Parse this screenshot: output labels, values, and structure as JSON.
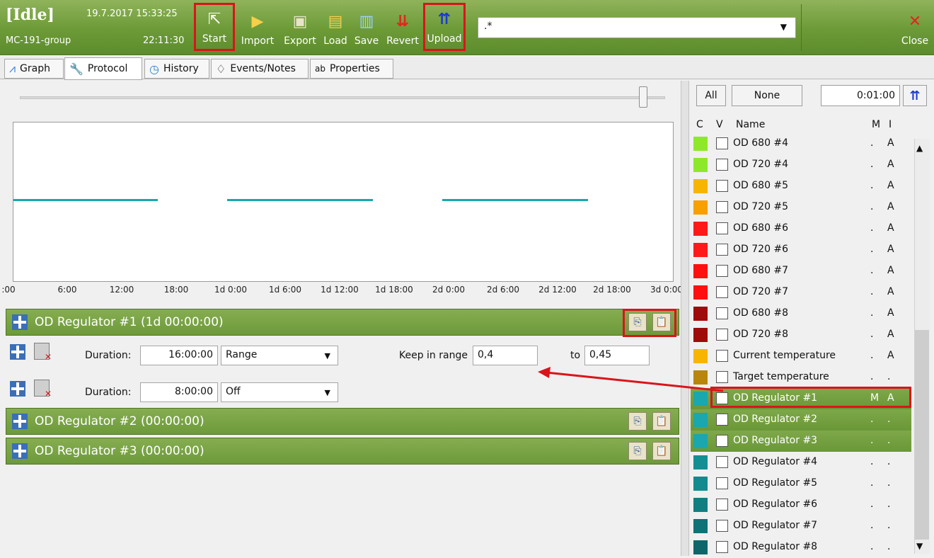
{
  "status": {
    "state": "[Idle]",
    "datetime": "19.7.2017 15:33:25",
    "group": "MC-191-group",
    "elapsed": "22:11:30"
  },
  "toolbar": {
    "start": "Start",
    "import": "Import",
    "export": "Export",
    "load": "Load",
    "save": "Save",
    "revert": "Revert",
    "upload": "Upload",
    "close": "Close",
    "filter_value": ".*"
  },
  "tabs": [
    "Graph",
    "Protocol",
    "History",
    "Events/Notes",
    "Properties"
  ],
  "graph": {
    "ticks": [
      ":00",
      "6:00",
      "12:00",
      "18:00",
      "1d 0:00",
      "1d 6:00",
      "1d 12:00",
      "1d 18:00",
      "2d 0:00",
      "2d 6:00",
      "2d 12:00",
      "2d 18:00",
      "3d 0:00"
    ]
  },
  "protocol": {
    "regulators": [
      {
        "title": "OD Regulator #1 (1d 00:00:00)"
      },
      {
        "title": "OD Regulator #2 (00:00:00)"
      },
      {
        "title": "OD Regulator #3 (00:00:00)"
      }
    ],
    "steps": [
      {
        "duration_label": "Duration:",
        "duration": "16:00:00",
        "mode": "Range",
        "keep_label": "Keep in range",
        "from": "0,4",
        "to_label": "to",
        "to": "0,45"
      },
      {
        "duration_label": "Duration:",
        "duration": "8:00:00",
        "mode": "Off"
      }
    ]
  },
  "channels": {
    "all_label": "All",
    "none_label": "None",
    "time": "0:01:00",
    "headers": {
      "c": "C",
      "v": "V",
      "name": "Name",
      "m": "M",
      "i": "I"
    },
    "items": [
      {
        "color": "#8ee82a",
        "checked": "",
        "name": "OD 680 #4",
        "m": ".",
        "i": "A"
      },
      {
        "color": "#8ee82a",
        "checked": "",
        "name": "OD 720 #4",
        "m": ".",
        "i": "A"
      },
      {
        "color": "#f7b500",
        "checked": "",
        "name": "OD 680 #5",
        "m": ".",
        "i": "A"
      },
      {
        "color": "#f7a000",
        "checked": "",
        "name": "OD 720 #5",
        "m": ".",
        "i": "A"
      },
      {
        "color": "#ff1a1a",
        "checked": "",
        "name": "OD 680 #6",
        "m": ".",
        "i": "A"
      },
      {
        "color": "#ff1a1a",
        "checked": "",
        "name": "OD 720 #6",
        "m": ".",
        "i": "A"
      },
      {
        "color": "#ff1010",
        "checked": "",
        "name": "OD 680 #7",
        "m": ".",
        "i": "A"
      },
      {
        "color": "#ff1010",
        "checked": "",
        "name": "OD 720 #7",
        "m": ".",
        "i": "A"
      },
      {
        "color": "#9e0b0b",
        "checked": "",
        "name": "OD 680 #8",
        "m": ".",
        "i": "A"
      },
      {
        "color": "#9e0b0b",
        "checked": "",
        "name": "OD 720 #8",
        "m": ".",
        "i": "A"
      },
      {
        "color": "#f7b500",
        "checked": "",
        "name": "Current temperature",
        "m": ".",
        "i": "A"
      },
      {
        "color": "#b8860b",
        "checked": "",
        "name": "Target temperature",
        "m": ".",
        "i": "."
      },
      {
        "color": "#1aa7ad",
        "checked": "✔",
        "name": "OD Regulator #1",
        "m": "M",
        "i": "A"
      },
      {
        "color": "#1aa7ad",
        "checked": "",
        "name": "OD Regulator #2",
        "m": ".",
        "i": "."
      },
      {
        "color": "#1aa7ad",
        "checked": "",
        "name": "OD Regulator #3",
        "m": ".",
        "i": "."
      },
      {
        "color": "#138f93",
        "checked": "",
        "name": "OD Regulator #4",
        "m": ".",
        "i": "."
      },
      {
        "color": "#138a8d",
        "checked": "",
        "name": "OD Regulator #5",
        "m": ".",
        "i": "."
      },
      {
        "color": "#117e82",
        "checked": "",
        "name": "OD Regulator #6",
        "m": ".",
        "i": "."
      },
      {
        "color": "#0f7276",
        "checked": "",
        "name": "OD Regulator #7",
        "m": ".",
        "i": "."
      },
      {
        "color": "#0d666a",
        "checked": "",
        "name": "OD Regulator #8",
        "m": ".",
        "i": "."
      }
    ]
  }
}
